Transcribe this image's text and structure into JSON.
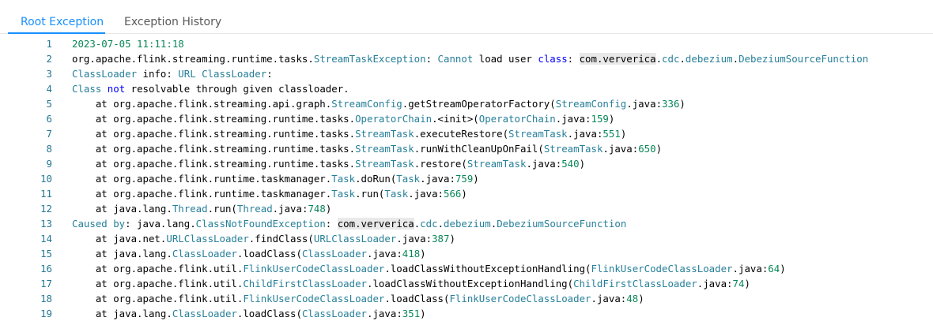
{
  "tabs": [
    {
      "label": "Root Exception",
      "active": true
    },
    {
      "label": "Exception History",
      "active": false
    }
  ],
  "colors": {
    "accent": "#1890ff",
    "line_number": "#237893",
    "type_name": "#267f99",
    "keyword": "#0000ff",
    "number": "#098658"
  },
  "editor": {
    "lines": [
      {
        "num": "1",
        "tokens": [
          [
            "n",
            "2023-07-05 11:11:18"
          ]
        ]
      },
      {
        "num": "2",
        "tokens": [
          [
            "p",
            "org.apache.flink.streaming.runtime.tasks."
          ],
          [
            "c",
            "StreamTaskException"
          ],
          [
            "p",
            ": "
          ],
          [
            "c",
            "Cannot"
          ],
          [
            "p",
            " load user "
          ],
          [
            "k",
            "class"
          ],
          [
            "p",
            ": "
          ],
          [
            "h",
            "com.ververica"
          ],
          [
            "p",
            "."
          ],
          [
            "c",
            "cdc"
          ],
          [
            "p",
            "."
          ],
          [
            "c",
            "debezium"
          ],
          [
            "p",
            "."
          ],
          [
            "c",
            "DebeziumSourceFunction"
          ]
        ]
      },
      {
        "num": "3",
        "tokens": [
          [
            "c",
            "ClassLoader"
          ],
          [
            "p",
            " info: "
          ],
          [
            "c",
            "URL ClassLoader"
          ],
          [
            "p",
            ":"
          ]
        ]
      },
      {
        "num": "4",
        "tokens": [
          [
            "c",
            "Class"
          ],
          [
            "p",
            " "
          ],
          [
            "k",
            "not"
          ],
          [
            "p",
            " resolvable through given classloader."
          ]
        ]
      },
      {
        "num": "5",
        "tokens": [
          [
            "p",
            "    at org.apache.flink.streaming.api.graph."
          ],
          [
            "c",
            "StreamConfig"
          ],
          [
            "p",
            ".getStreamOperatorFactory("
          ],
          [
            "c",
            "StreamConfig"
          ],
          [
            "p",
            ".java:"
          ],
          [
            "n",
            "336"
          ],
          [
            "p",
            ")"
          ]
        ]
      },
      {
        "num": "6",
        "tokens": [
          [
            "p",
            "    at org.apache.flink.streaming.runtime.tasks."
          ],
          [
            "c",
            "OperatorChain"
          ],
          [
            "p",
            ".<init>("
          ],
          [
            "c",
            "OperatorChain"
          ],
          [
            "p",
            ".java:"
          ],
          [
            "n",
            "159"
          ],
          [
            "p",
            ")"
          ]
        ]
      },
      {
        "num": "7",
        "tokens": [
          [
            "p",
            "    at org.apache.flink.streaming.runtime.tasks."
          ],
          [
            "c",
            "StreamTask"
          ],
          [
            "p",
            ".executeRestore("
          ],
          [
            "c",
            "StreamTask"
          ],
          [
            "p",
            ".java:"
          ],
          [
            "n",
            "551"
          ],
          [
            "p",
            ")"
          ]
        ]
      },
      {
        "num": "8",
        "tokens": [
          [
            "p",
            "    at org.apache.flink.streaming.runtime.tasks."
          ],
          [
            "c",
            "StreamTask"
          ],
          [
            "p",
            ".runWithCleanUpOnFail("
          ],
          [
            "c",
            "StreamTask"
          ],
          [
            "p",
            ".java:"
          ],
          [
            "n",
            "650"
          ],
          [
            "p",
            ")"
          ]
        ]
      },
      {
        "num": "9",
        "tokens": [
          [
            "p",
            "    at org.apache.flink.streaming.runtime.tasks."
          ],
          [
            "c",
            "StreamTask"
          ],
          [
            "p",
            ".restore("
          ],
          [
            "c",
            "StreamTask"
          ],
          [
            "p",
            ".java:"
          ],
          [
            "n",
            "540"
          ],
          [
            "p",
            ")"
          ]
        ]
      },
      {
        "num": "10",
        "tokens": [
          [
            "p",
            "    at org.apache.flink.runtime.taskmanager."
          ],
          [
            "c",
            "Task"
          ],
          [
            "p",
            ".doRun("
          ],
          [
            "c",
            "Task"
          ],
          [
            "p",
            ".java:"
          ],
          [
            "n",
            "759"
          ],
          [
            "p",
            ")"
          ]
        ]
      },
      {
        "num": "11",
        "tokens": [
          [
            "p",
            "    at org.apache.flink.runtime.taskmanager."
          ],
          [
            "c",
            "Task"
          ],
          [
            "p",
            ".run("
          ],
          [
            "c",
            "Task"
          ],
          [
            "p",
            ".java:"
          ],
          [
            "n",
            "566"
          ],
          [
            "p",
            ")"
          ]
        ]
      },
      {
        "num": "12",
        "tokens": [
          [
            "p",
            "    at java.lang."
          ],
          [
            "c",
            "Thread"
          ],
          [
            "p",
            ".run("
          ],
          [
            "c",
            "Thread"
          ],
          [
            "p",
            ".java:"
          ],
          [
            "n",
            "748"
          ],
          [
            "p",
            ")"
          ]
        ]
      },
      {
        "num": "13",
        "tokens": [
          [
            "c",
            "Caused by"
          ],
          [
            "p",
            ": java.lang."
          ],
          [
            "c",
            "ClassNotFoundException"
          ],
          [
            "p",
            ": "
          ],
          [
            "h",
            "com.ververica"
          ],
          [
            "p",
            "."
          ],
          [
            "c",
            "cdc"
          ],
          [
            "p",
            "."
          ],
          [
            "c",
            "debezium"
          ],
          [
            "p",
            "."
          ],
          [
            "c",
            "DebeziumSourceFunction"
          ]
        ]
      },
      {
        "num": "14",
        "tokens": [
          [
            "p",
            "    at java.net."
          ],
          [
            "c",
            "URLClassLoader"
          ],
          [
            "p",
            ".findClass("
          ],
          [
            "c",
            "URLClassLoader"
          ],
          [
            "p",
            ".java:"
          ],
          [
            "n",
            "387"
          ],
          [
            "p",
            ")"
          ]
        ]
      },
      {
        "num": "15",
        "tokens": [
          [
            "p",
            "    at java.lang."
          ],
          [
            "c",
            "ClassLoader"
          ],
          [
            "p",
            ".loadClass("
          ],
          [
            "c",
            "ClassLoader"
          ],
          [
            "p",
            ".java:"
          ],
          [
            "n",
            "418"
          ],
          [
            "p",
            ")"
          ]
        ]
      },
      {
        "num": "16",
        "tokens": [
          [
            "p",
            "    at org.apache.flink.util."
          ],
          [
            "c",
            "FlinkUserCodeClassLoader"
          ],
          [
            "p",
            ".loadClassWithoutExceptionHandling("
          ],
          [
            "c",
            "FlinkUserCodeClassLoader"
          ],
          [
            "p",
            ".java:"
          ],
          [
            "n",
            "64"
          ],
          [
            "p",
            ")"
          ]
        ]
      },
      {
        "num": "17",
        "tokens": [
          [
            "p",
            "    at org.apache.flink.util."
          ],
          [
            "c",
            "ChildFirstClassLoader"
          ],
          [
            "p",
            ".loadClassWithoutExceptionHandling("
          ],
          [
            "c",
            "ChildFirstClassLoader"
          ],
          [
            "p",
            ".java:"
          ],
          [
            "n",
            "74"
          ],
          [
            "p",
            ")"
          ]
        ]
      },
      {
        "num": "18",
        "tokens": [
          [
            "p",
            "    at org.apache.flink.util."
          ],
          [
            "c",
            "FlinkUserCodeClassLoader"
          ],
          [
            "p",
            ".loadClass("
          ],
          [
            "c",
            "FlinkUserCodeClassLoader"
          ],
          [
            "p",
            ".java:"
          ],
          [
            "n",
            "48"
          ],
          [
            "p",
            ")"
          ]
        ]
      },
      {
        "num": "19",
        "tokens": [
          [
            "p",
            "    at java.lang."
          ],
          [
            "c",
            "ClassLoader"
          ],
          [
            "p",
            ".loadClass("
          ],
          [
            "c",
            "ClassLoader"
          ],
          [
            "p",
            ".java:"
          ],
          [
            "n",
            "351"
          ],
          [
            "p",
            ")"
          ]
        ]
      }
    ]
  }
}
